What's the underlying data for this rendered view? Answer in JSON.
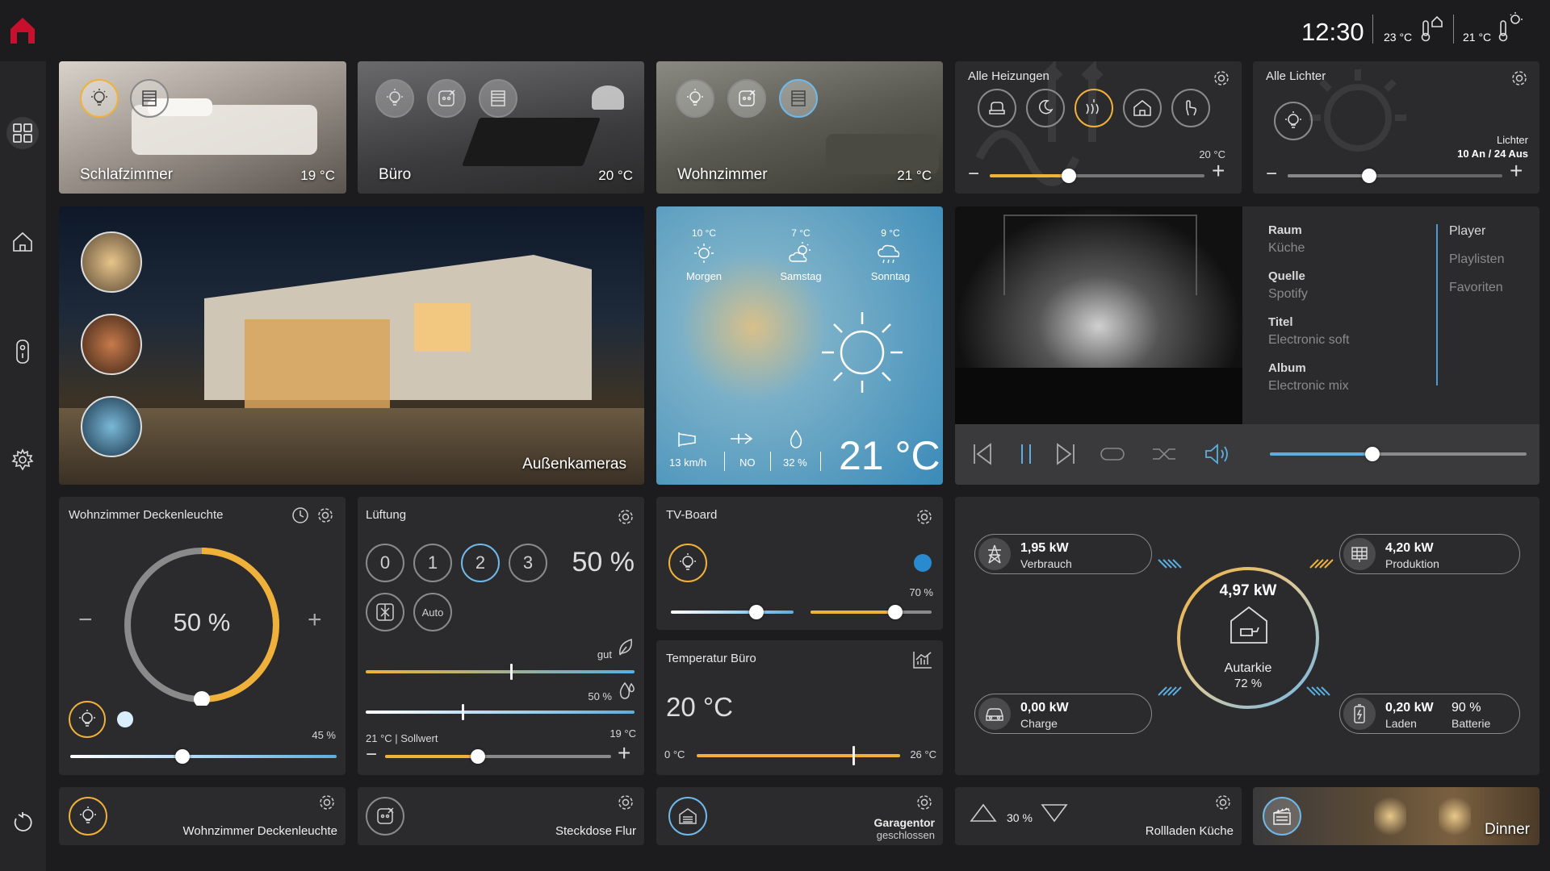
{
  "header": {
    "time": "12:30",
    "temp_inside": "23 °C",
    "temp_outside": "21 °C"
  },
  "rooms": [
    {
      "name": "Schlafzimmer",
      "temp": "19 °C"
    },
    {
      "name": "Büro",
      "temp": "20 °C"
    },
    {
      "name": "Wohnzimmer",
      "temp": "21 °C"
    }
  ],
  "heating": {
    "title": "Alle Heizungen",
    "setpoint": "20 °C",
    "modes": [
      "comfort-icon",
      "night-icon",
      "heat-icon",
      "away-icon",
      "manual-icon"
    ],
    "active_mode": 2,
    "level": 0.37
  },
  "lights_all": {
    "title": "Alle Lichter",
    "label": "Lichter",
    "status": "10 An / 24 Aus",
    "level": 0.38
  },
  "cameras": {
    "label": "Außenkameras"
  },
  "weather": {
    "forecast": [
      {
        "temp": "10 °C",
        "day": "Morgen",
        "icon": "sun-icon"
      },
      {
        "temp": "7 °C",
        "day": "Samstag",
        "icon": "partly-cloudy-icon"
      },
      {
        "temp": "9 °C",
        "day": "Sonntag",
        "icon": "rain-icon"
      }
    ],
    "wind_speed": "13 km/h",
    "wind_dir": "NO",
    "humidity": "32 %",
    "temp": "21 °C"
  },
  "media": {
    "fields": [
      {
        "label": "Raum",
        "value": "Küche"
      },
      {
        "label": "Quelle",
        "value": "Spotify"
      },
      {
        "label": "Titel",
        "value": "Electronic soft"
      },
      {
        "label": "Album",
        "value": "Electronic mix"
      }
    ],
    "tabs": [
      "Player",
      "Playlisten",
      "Favoriten"
    ],
    "volume": 0.4
  },
  "ceiling_light": {
    "title": "Wohnzimmer Deckenleuchte",
    "dimmer": "50 %",
    "dimmer_level": 0.5,
    "brightness": "45 %",
    "brightness_level": 0.42
  },
  "ventilation": {
    "title": "Lüftung",
    "levels": [
      "0",
      "1",
      "2",
      "3"
    ],
    "active_level": 2,
    "percent": "50 %",
    "auto_label": "Auto",
    "air_quality": "gut",
    "air_level": 0.54,
    "humidity": "50 %",
    "humidity_level": 0.36,
    "setpoint_label": "21 °C | Sollwert",
    "setpoint_value": "19 °C",
    "setpoint_level": 0.41
  },
  "tv_board": {
    "title": "TV-Board",
    "white_level": 0.7,
    "warm_level": 0.7,
    "warm_label": "70 %"
  },
  "temperature": {
    "title": "Temperatur Büro",
    "value": "20 °C",
    "min": "0 °C",
    "max": "26 °C",
    "level": 0.77
  },
  "energy": {
    "consumption": {
      "value": "1,95 kW",
      "label": "Verbrauch"
    },
    "production": {
      "value": "4,20 kW",
      "label": "Produktion"
    },
    "charge": {
      "value": "0,00 kW",
      "label": "Charge"
    },
    "battery": {
      "value": "0,20 kW",
      "label": "Laden",
      "percent": "90 %",
      "percent_label": "Batterie"
    },
    "center_value": "4,97 kW",
    "center_label": "Autarkie",
    "center_percent": "72 %"
  },
  "bottom": {
    "light": "Wohnzimmer Deckenleuchte",
    "socket": "Steckdose Flur",
    "garage": "Garagentor",
    "garage_status": "geschlossen",
    "shutter_percent": "30 %",
    "shutter": "Rollladen Küche",
    "scene": "Dinner"
  },
  "colors": {
    "accent_orange": "#f0b13a",
    "accent_blue": "#6fb8e8",
    "brand_red": "#c8102e"
  }
}
